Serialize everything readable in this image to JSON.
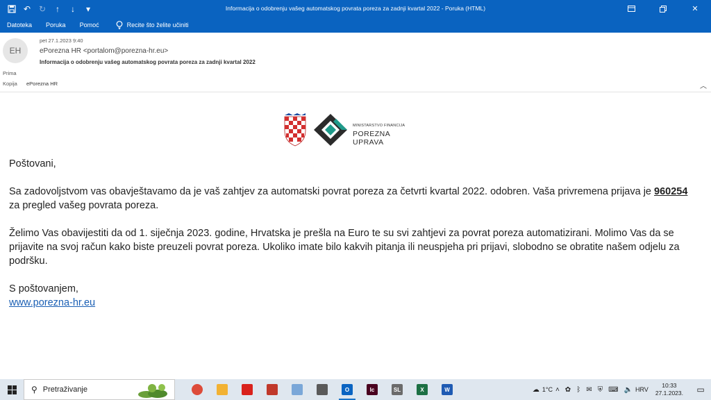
{
  "window": {
    "title": "Informacija o odobrenju vašeg automatskog povrata poreza za zadnji kvartal 2022  -  Poruka (HTML)",
    "quick_access": [
      "save-icon",
      "undo-icon",
      "redo-icon",
      "up-arrow-icon",
      "down-arrow-icon",
      "more-icon"
    ],
    "controls": [
      "restore-icon",
      "maximize-icon",
      "close-icon"
    ]
  },
  "ribbon": {
    "tabs": [
      "Datoteka",
      "Poruka",
      "Pomoć"
    ],
    "tell_me": "Recite što želite učiniti"
  },
  "header": {
    "avatar": "EH",
    "date": "pet 27.1.2023 9:40",
    "from": "ePorezna HR <portalom@porezna-hr.eu>",
    "subject": "Informacija o odobrenju vašeg automatskog povrata poreza za zadnji kvartal 2022",
    "to_label": "Prima",
    "cc_label": "Kopija",
    "cc_value": "ePorezna HR"
  },
  "logo": {
    "line1": "MINISTARSTVO FINANCIJA",
    "line2": "POREZNA UPRAVA"
  },
  "message": {
    "greeting": "Poštovani,",
    "p1_before": "Sa zadovoljstvom vas obavještavamo da je vaš zahtjev za automatski povrat poreza za četvrti kvartal 2022. odobren. Vaša privremena prijava je ",
    "p1_code": "960254",
    "p1_after": " za pregled vašeg povrata poreza.",
    "p2": "Želimo Vas obavijestiti da od 1. siječnja 2023. godine, Hrvatska je prešla na Euro te su svi zahtjevi za povrat poreza automatizirani. Molimo Vas da se prijavite na svoj račun kako biste preuzeli povrat poreza. Ukoliko imate bilo kakvih pitanja ili neuspjeha pri prijavi, slobodno se obratite našem odjelu za podršku.",
    "closing": "S poštovanjem,",
    "link": "www.porezna-hr.eu"
  },
  "taskbar": {
    "search_placeholder": "Pretraživanje",
    "apps": [
      {
        "name": "chrome",
        "label": "",
        "color": "#dd4b39"
      },
      {
        "name": "file-explorer",
        "label": "",
        "color": "#f2b233"
      },
      {
        "name": "acrobat",
        "label": "",
        "color": "#d9221c"
      },
      {
        "name": "puzzle",
        "label": "",
        "color": "#c0392b"
      },
      {
        "name": "paint",
        "label": "",
        "color": "#7aa7d8"
      },
      {
        "name": "calculator",
        "label": "",
        "color": "#5a5a5a"
      },
      {
        "name": "outlook",
        "label": "O",
        "color": "#0a64c2"
      },
      {
        "name": "indesign",
        "label": "Ic",
        "color": "#49021f"
      },
      {
        "name": "sl-app",
        "label": "SL",
        "color": "#6b6b6b"
      },
      {
        "name": "excel",
        "label": "X",
        "color": "#1d7044"
      },
      {
        "name": "word",
        "label": "W",
        "color": "#1f5bb3"
      }
    ],
    "temperature": "1°C",
    "language": "HRV",
    "time": "10:33",
    "date": "27.1.2023."
  }
}
